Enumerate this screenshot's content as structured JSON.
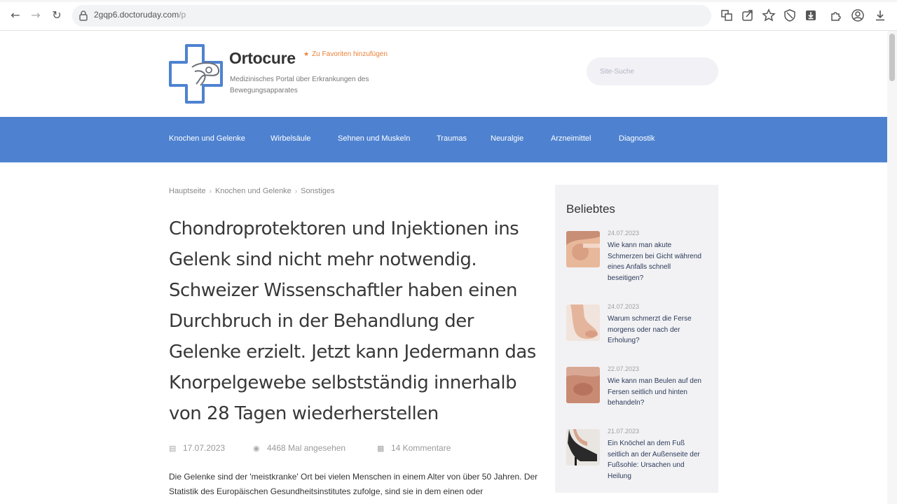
{
  "browser": {
    "url_host": "2gqp6.doctoruday.com",
    "url_path": "/p"
  },
  "site": {
    "title": "Ortocure",
    "favorite_label": "Zu Favoriten hinzufügen",
    "tagline": "Medizinisches Portal über Erkrankungen des Bewegungsapparates",
    "search_placeholder": "Site-Suche",
    "brand_color": "#4e82d0"
  },
  "nav": {
    "items": [
      {
        "label": "Knochen und Gelenke"
      },
      {
        "label": "Wirbelsäule"
      },
      {
        "label": "Sehnen und Muskeln"
      },
      {
        "label": "Traumas"
      },
      {
        "label": "Neuralgie"
      },
      {
        "label": "Arzneimittel"
      },
      {
        "label": "Diagnostik"
      }
    ]
  },
  "breadcrumb": [
    "Hauptseite",
    "Knochen und Gelenke",
    "Sonstiges"
  ],
  "article": {
    "title": "Chondroprotektoren und Injektionen ins Gelenk sind nicht mehr notwendig. Schweizer Wissenschaftler haben einen Durchbruch in der Behandlung der Gelenke erzielt. Jetzt kann Jedermann das Knorpelgewebe selbstständig innerhalb von 28 Tagen wiederherstellen",
    "date": "17.07.2023",
    "views": "4468 Mal angesehen",
    "comments": "14 Kommentare",
    "body": "Die Gelenke sind der 'meistkranke' Ort bei vielen Menschen in einem Alter von über 50 Jahren. Der Statistik des Europäischen Gesundheitsinstitutes zufolge, sind sie in dem einen oder"
  },
  "sidebar": {
    "heading": "Beliebtes",
    "posts": [
      {
        "date": "24.07.2023",
        "title": "Wie kann man akute Schmerzen bei Gicht während eines Anfalls schnell beseitigen?"
      },
      {
        "date": "24.07.2023",
        "title": "Warum schmerzt die Ferse morgens oder nach der Erholung?"
      },
      {
        "date": "22.07.2023",
        "title": "Wie kann man Beulen auf den Fersen seitlich und hinten behandeln?"
      },
      {
        "date": "21.07.2023",
        "title": "Ein Knöchel an dem Fuß seitlich an der Außenseite der Fußsohle: Ursachen und Heilung"
      }
    ]
  }
}
